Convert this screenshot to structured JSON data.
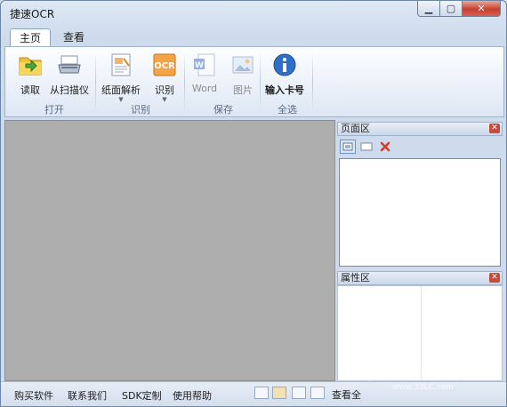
{
  "window": {
    "title": "捷速OCR"
  },
  "tabs": [
    {
      "label": "主页",
      "active": true
    },
    {
      "label": "查看",
      "active": false
    }
  ],
  "ribbon": {
    "groups": [
      {
        "label": "打开",
        "buttons": [
          {
            "label": "读取",
            "icon": "folder-icon"
          },
          {
            "label": "从扫描仪",
            "icon": "scanner-icon"
          }
        ]
      },
      {
        "label": "识别",
        "buttons": [
          {
            "label": "纸面解析",
            "icon": "page-analysis-icon",
            "dropdown": true
          },
          {
            "label": "识别",
            "icon": "ocr-icon",
            "dropdown": true
          }
        ]
      },
      {
        "label": "保存",
        "buttons": [
          {
            "label": "Word",
            "icon": "word-doc-icon",
            "disabled": true
          },
          {
            "label": "图片",
            "icon": "picture-icon",
            "disabled": true
          }
        ]
      },
      {
        "label": "全选",
        "buttons": [
          {
            "label": "输入卡号",
            "icon": "info-icon"
          }
        ]
      }
    ]
  },
  "panels": {
    "page_area": {
      "title": "页面区"
    },
    "property_area": {
      "title": "属性区"
    }
  },
  "statusbar": {
    "links": [
      "购买软件",
      "联系我们",
      "SDK定制",
      "使用帮助"
    ],
    "view_label": "查看全"
  },
  "watermark": {
    "text": "绿茶软件园",
    "url": "www.33LC.com"
  }
}
